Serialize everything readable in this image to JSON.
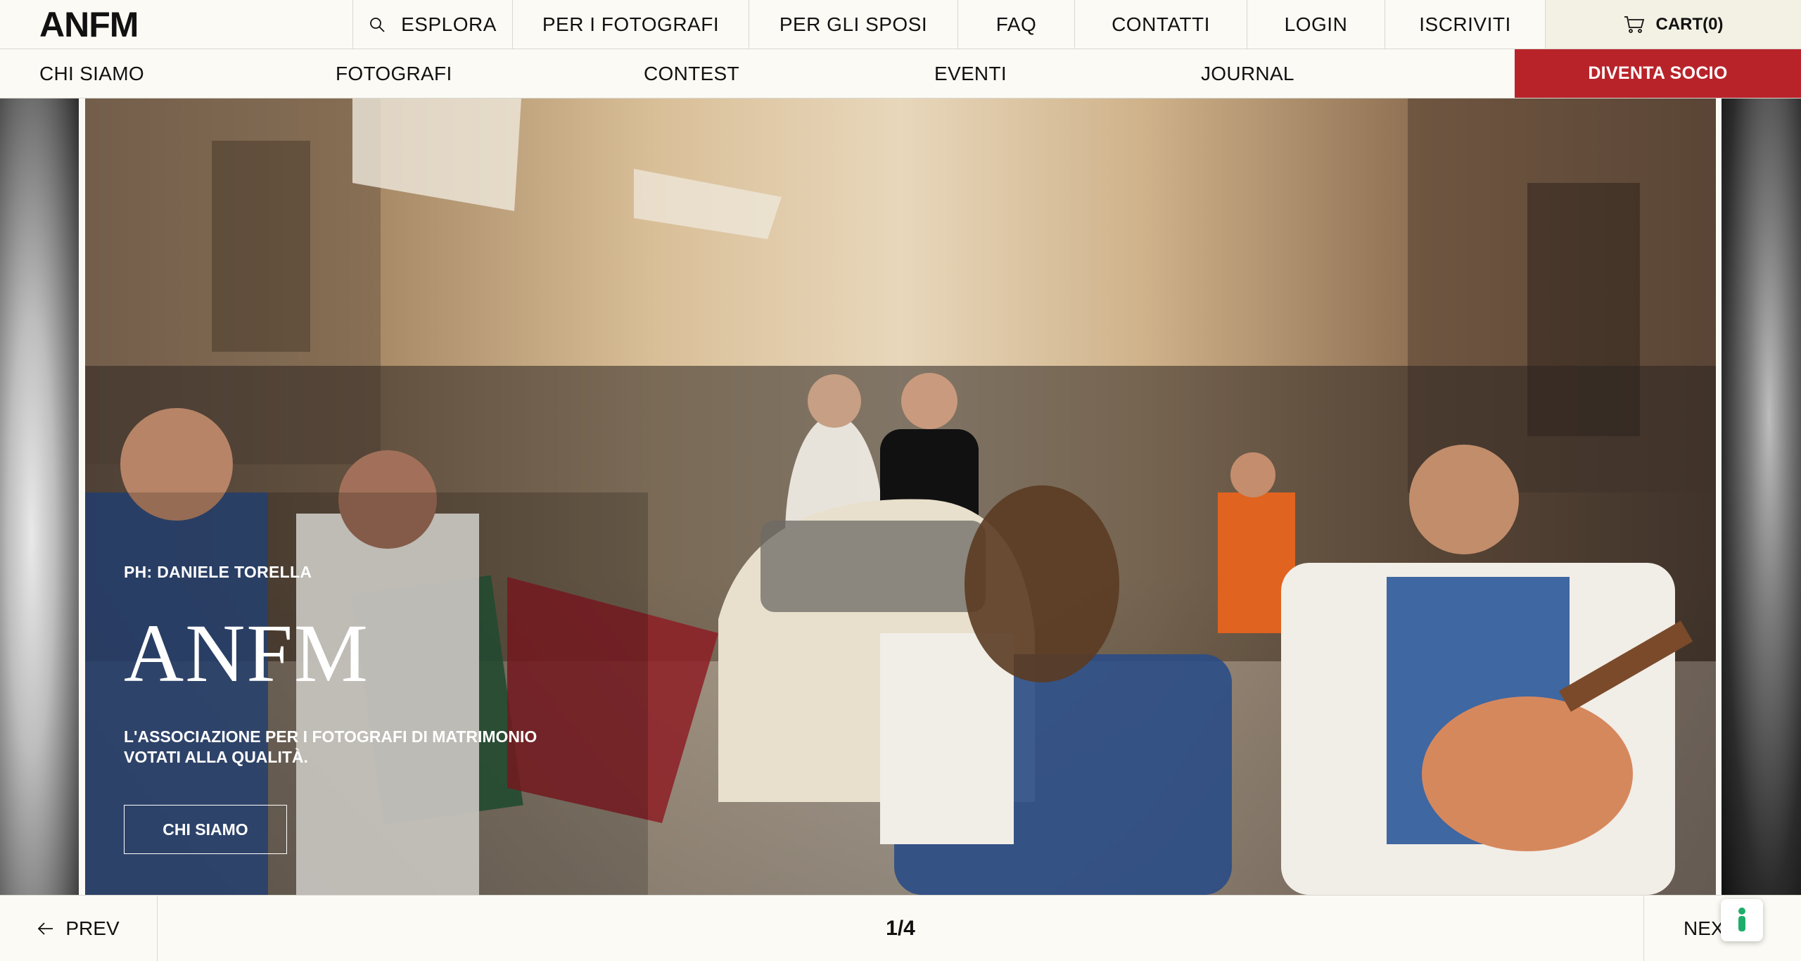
{
  "brand": {
    "logo": "ANFM"
  },
  "top_nav": {
    "search_label": "ESPLORA",
    "items": [
      "PER I FOTOGRAFI",
      "PER GLI SPOSI",
      "FAQ",
      "CONTATTI",
      "LOGIN",
      "ISCRIVITI"
    ],
    "cart_label": "CART(0)"
  },
  "sub_nav": {
    "items": [
      "CHI SIAMO",
      "FOTOGRAFI",
      "CONTEST",
      "EVENTI",
      "JOURNAL"
    ],
    "cta_label": "DIVENTA SOCIO"
  },
  "hero": {
    "credit": "PH: DANIELE TORELLA",
    "title": "ANFM",
    "subtitle_line1": "L'ASSOCIAZIONE PER I FOTOGRAFI DI MATRIMONIO",
    "subtitle_line2": "VOTATI ALLA QUALITÀ.",
    "button_label": "CHI SIAMO"
  },
  "slider": {
    "prev_label": "PREV",
    "next_label": "NEXT",
    "counter": "1/4"
  },
  "colors": {
    "background": "#fbfaf4",
    "accent_red": "#b8232a",
    "cart_bg": "#f3f0e4",
    "cookie_icon": "#1fae6a"
  }
}
